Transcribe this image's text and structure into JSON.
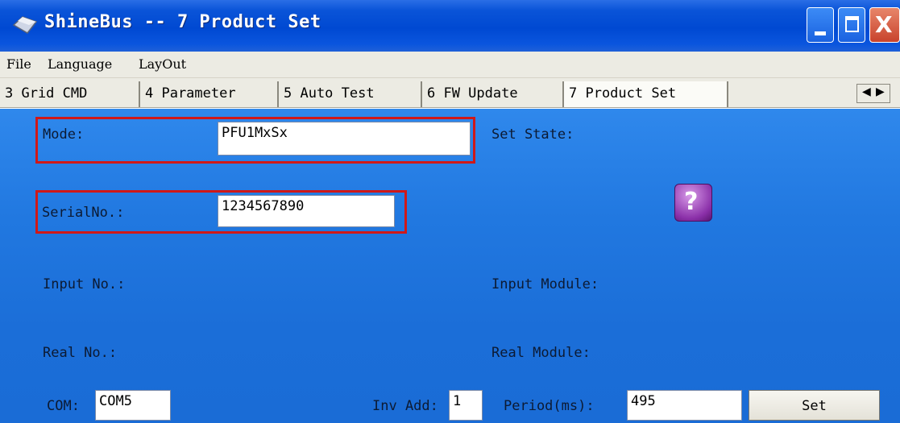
{
  "window": {
    "title": "ShineBus -- 7 Product Set",
    "close_glyph": "X"
  },
  "menu": [
    "File",
    "Language",
    "LayOut"
  ],
  "tabs": [
    "3 Grid CMD",
    "4 Parameter",
    "5 Auto Test",
    "6 FW Update",
    "7 Product Set"
  ],
  "active_tab": "7 Product Set",
  "tab_scroll": {
    "left": "◀",
    "right": "▶"
  },
  "form": {
    "mode_label": "Mode:",
    "mode_value": "PFU1MxSx",
    "serial_label": "SerialNo.:",
    "serial_value": "1234567890",
    "set_state_label": "Set State:",
    "input_no_label": "Input No.:",
    "input_module_label": "Input Module:",
    "real_no_label": "Real No.:",
    "real_module_label": "Real Module:",
    "com_label": "COM:",
    "com_value": "COM5",
    "inv_add_label": "Inv Add:",
    "inv_add_value": "1",
    "period_label": "Period(ms):",
    "period_value": "495",
    "set_button": "Set",
    "help_glyph": "?"
  },
  "colors": {
    "titlebar": "#0049d2",
    "panel": "#2178e0",
    "highlight": "#d01818"
  }
}
